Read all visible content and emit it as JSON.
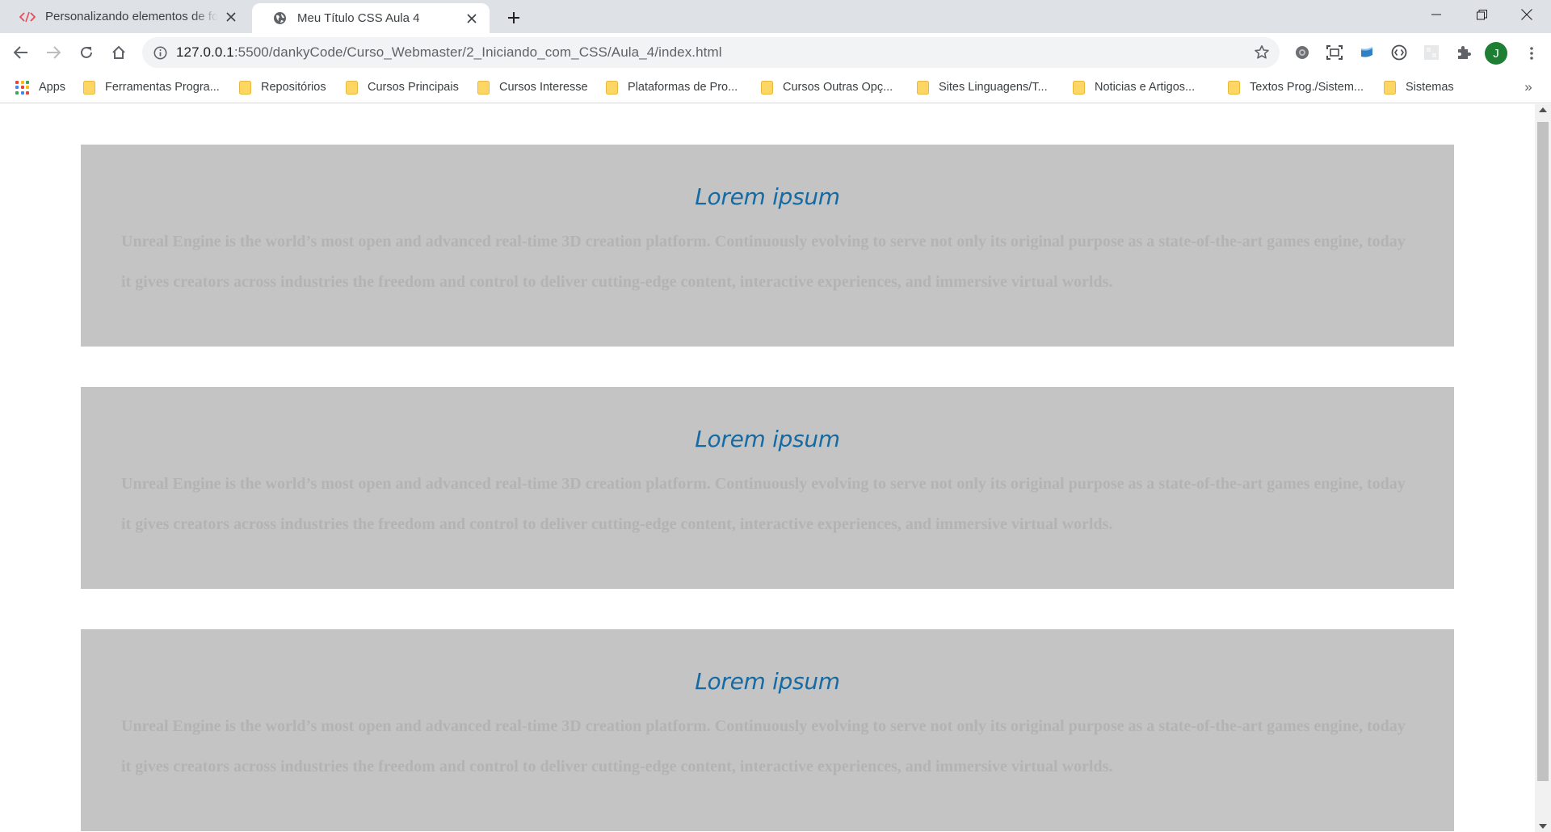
{
  "browser": {
    "tabs": [
      {
        "title": "Personalizando elementos de for",
        "favicon": "code-icon",
        "active": false
      },
      {
        "title": "Meu Título CSS Aula 4",
        "favicon": "globe-icon",
        "active": true
      }
    ],
    "address": {
      "host": "127.0.0.1",
      "path": ":5500/dankyCode/Curso_Webmaster/2_Iniciando_com_CSS/Aula_4/index.html"
    },
    "profile_initial": "J",
    "bookmarks": [
      "Apps",
      "Ferramentas Progra...",
      "Repositórios",
      "Cursos Principais",
      "Cursos Interesse",
      "Plataformas de Pro...",
      "Cursos Outras Opç...",
      "Sites Linguagens/T...",
      "Noticias e Artigos...",
      "Textos Prog./Sistem...",
      "Sistemas"
    ],
    "bookmarks_overflow": "»"
  },
  "colors": {
    "section_bg": "#c4c4c4",
    "heading": "#146aa3",
    "paragraph": "#b3b3b3",
    "folder": "#fdd663",
    "avatar": "#1e7e34"
  },
  "page": {
    "sections": [
      {
        "heading": "Lorem ipsum",
        "text": "Unreal Engine is the world’s most open and advanced real-time 3D creation platform. Continuously evolving to serve not only its original purpose as a state-of-the-art games engine, today it gives creators across industries the freedom and control to deliver cutting-edge content, interactive experiences, and immersive virtual worlds."
      },
      {
        "heading": "Lorem ipsum",
        "text": "Unreal Engine is the world’s most open and advanced real-time 3D creation platform. Continuously evolving to serve not only its original purpose as a state-of-the-art games engine, today it gives creators across industries the freedom and control to deliver cutting-edge content, interactive experiences, and immersive virtual worlds."
      },
      {
        "heading": "Lorem ipsum",
        "text": "Unreal Engine is the world’s most open and advanced real-time 3D creation platform. Continuously evolving to serve not only its original purpose as a state-of-the-art games engine, today it gives creators across industries the freedom and control to deliver cutting-edge content, interactive experiences, and immersive virtual worlds."
      }
    ]
  }
}
